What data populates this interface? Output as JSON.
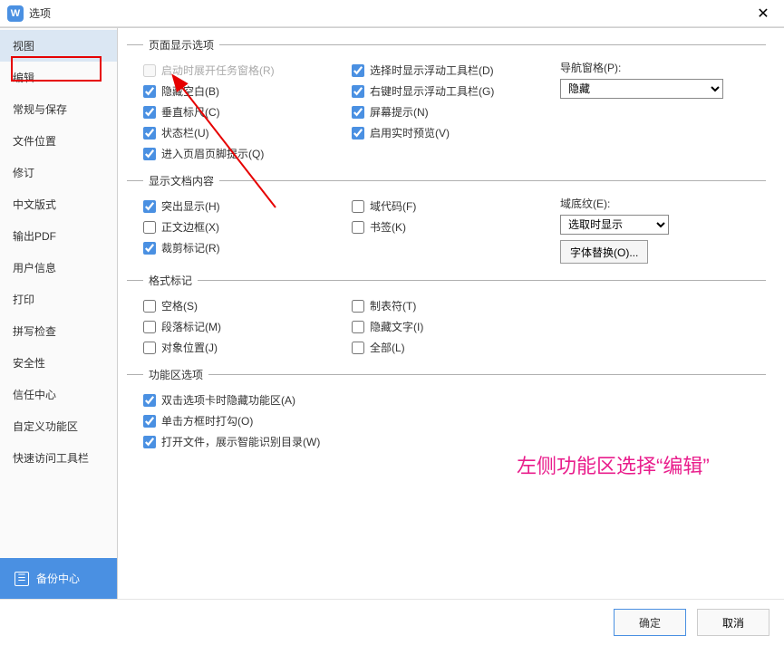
{
  "titlebar": {
    "title": "选项",
    "close": "✕",
    "app_icon_text": "W"
  },
  "sidebar": {
    "items": [
      {
        "label": "视图",
        "active": true
      },
      {
        "label": "编辑"
      },
      {
        "label": "常规与保存"
      },
      {
        "label": "文件位置"
      },
      {
        "label": "修订"
      },
      {
        "label": "中文版式"
      },
      {
        "label": "输出PDF"
      },
      {
        "label": "用户信息"
      },
      {
        "label": "打印"
      },
      {
        "label": "拼写检查"
      },
      {
        "label": "安全性"
      },
      {
        "label": "信任中心"
      },
      {
        "label": "自定义功能区"
      },
      {
        "label": "快速访问工具栏"
      }
    ],
    "backup_label": "备份中心"
  },
  "groups": {
    "page_display": {
      "legend": "页面显示选项",
      "col1": [
        {
          "label": "启动时展开任务窗格(R)",
          "checked": false,
          "disabled": true
        },
        {
          "label": "隐藏空白(B)",
          "checked": true
        },
        {
          "label": "垂直标尺(C)",
          "checked": true
        },
        {
          "label": "状态栏(U)",
          "checked": true
        },
        {
          "label": "进入页眉页脚提示(Q)",
          "checked": true
        }
      ],
      "col2": [
        {
          "label": "选择时显示浮动工具栏(D)",
          "checked": true
        },
        {
          "label": "右键时显示浮动工具栏(G)",
          "checked": true
        },
        {
          "label": "屏幕提示(N)",
          "checked": true
        },
        {
          "label": "启用实时预览(V)",
          "checked": true
        }
      ],
      "nav": {
        "label": "导航窗格(P):",
        "value": "隐藏"
      }
    },
    "doc_content": {
      "legend": "显示文档内容",
      "col1": [
        {
          "label": "突出显示(H)",
          "checked": true
        },
        {
          "label": "正文边框(X)",
          "checked": false
        },
        {
          "label": "裁剪标记(R)",
          "checked": true
        }
      ],
      "col2": [
        {
          "label": "域代码(F)",
          "checked": false
        },
        {
          "label": "书签(K)",
          "checked": false
        }
      ],
      "shading": {
        "label": "域底纹(E):",
        "value": "选取时显示"
      },
      "font_replace_btn": "字体替换(O)..."
    },
    "format_marks": {
      "legend": "格式标记",
      "col1": [
        {
          "label": "空格(S)",
          "checked": false
        },
        {
          "label": "段落标记(M)",
          "checked": false
        },
        {
          "label": "对象位置(J)",
          "checked": false
        }
      ],
      "col2": [
        {
          "label": "制表符(T)",
          "checked": false
        },
        {
          "label": "隐藏文字(I)",
          "checked": false
        },
        {
          "label": "全部(L)",
          "checked": false
        }
      ]
    },
    "ribbon": {
      "legend": "功能区选项",
      "items": [
        {
          "label": "双击选项卡时隐藏功能区(A)",
          "checked": true
        },
        {
          "label": "单击方框时打勾(O)",
          "checked": true
        },
        {
          "label": "打开文件，展示智能识别目录(W)",
          "checked": true
        }
      ]
    }
  },
  "annotation": "左侧功能区选择“编辑”",
  "footer": {
    "ok": "确定",
    "cancel": "取消"
  }
}
